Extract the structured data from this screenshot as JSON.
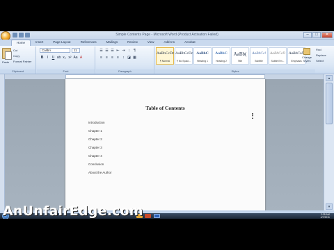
{
  "window": {
    "title": "Simple Contents Page - Microsoft Word (Product Activation Failed)",
    "controls": [
      "–",
      "□",
      "✕"
    ]
  },
  "ribbon": {
    "tabs": [
      "Home",
      "Insert",
      "Page Layout",
      "References",
      "Mailings",
      "Review",
      "View",
      "Add-Ins",
      "Acrobat"
    ],
    "active_tab": "Home",
    "clipboard": {
      "paste_label": "Paste",
      "cut": "Cut",
      "copy": "Copy",
      "format_painter": "Format Painter",
      "group_label": "Clipboard"
    },
    "font": {
      "name": "Calibri",
      "size": "11",
      "group_label": "Font"
    },
    "paragraph": {
      "group_label": "Paragraph"
    },
    "styles": {
      "group_label": "Styles",
      "items": [
        {
          "sample": "AaBbCcDc",
          "name": "¶ Normal"
        },
        {
          "sample": "AaBbCcDc",
          "name": "¶ No Spaci..."
        },
        {
          "sample": "AaBbC",
          "name": "Heading 1"
        },
        {
          "sample": "AaBbC",
          "name": "Heading 2"
        },
        {
          "sample": "AaBb(",
          "name": "Title"
        },
        {
          "sample": "AaBbCcl",
          "name": "Subtitle"
        },
        {
          "sample": "AaBbCcD",
          "name": "Subtle Em..."
        },
        {
          "sample": "AaBbCcD",
          "name": "Emphasis"
        }
      ],
      "change_styles": "Change Styles"
    },
    "editing": {
      "find": "Find",
      "replace": "Replace",
      "select": "Select",
      "group_label": "Editing"
    }
  },
  "document": {
    "heading": "Table of Contents",
    "items": [
      "Introduction",
      "Chapter 1",
      "Chapter 2",
      "Chapter 3",
      "Chapter 4",
      "Conclusion",
      "About the Author"
    ]
  },
  "taskbar": {
    "time": "2:35 AM",
    "date": "4/7/2011"
  },
  "watermark": "AnUnfairEdge.com"
}
